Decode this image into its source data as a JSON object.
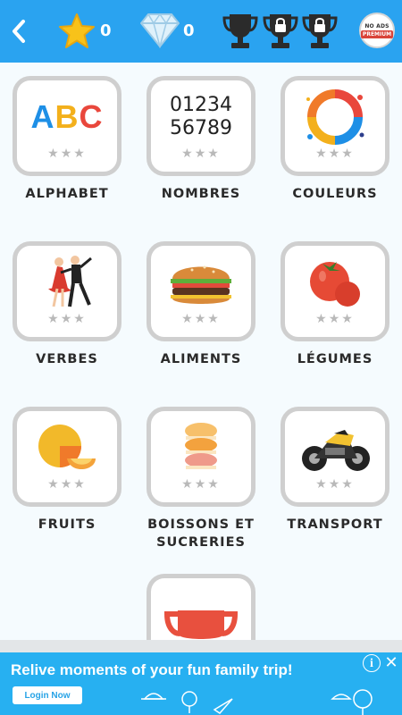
{
  "header": {
    "stars_count": "0",
    "gems_count": "0",
    "no_ads_line1": "NO ADS",
    "no_ads_line2": "PREMIUM"
  },
  "categories": [
    {
      "label": "ALPHABET",
      "icon": "abc-letters-icon",
      "stars": "★★★"
    },
    {
      "label": "NOMBRES",
      "icon": "digits-icon",
      "stars": "★★★"
    },
    {
      "label": "COULEURS",
      "icon": "paint-splash-icon",
      "stars": "★★★"
    },
    {
      "label": "VERBES",
      "icon": "dancers-icon",
      "stars": "★★★"
    },
    {
      "label": "ALIMENTS",
      "icon": "burger-icon",
      "stars": "★★★"
    },
    {
      "label": "LÉGUMES",
      "icon": "tomato-icon",
      "stars": "★★★"
    },
    {
      "label": "FRUITS",
      "icon": "melon-icon",
      "stars": "★★★"
    },
    {
      "label": "BOISSONS ET SUCRERIES",
      "icon": "macaron-icon",
      "stars": "★★★"
    },
    {
      "label": "TRANSPORT",
      "icon": "motorcycle-icon",
      "stars": "★★★"
    }
  ],
  "tile_art": {
    "abc": {
      "a": "A",
      "b": "B",
      "c": "C"
    },
    "digits": {
      "line1": "01234",
      "line2": "56789"
    }
  },
  "ad": {
    "headline": "Relive moments of your fun family trip!",
    "button": "Login Now",
    "info": "i",
    "close": "✕"
  },
  "colors": {
    "header_bg": "#2aa3f0",
    "star": "#f8c21a",
    "tile_border": "#cfcfcf",
    "ad_bg": "#27b0f1"
  }
}
